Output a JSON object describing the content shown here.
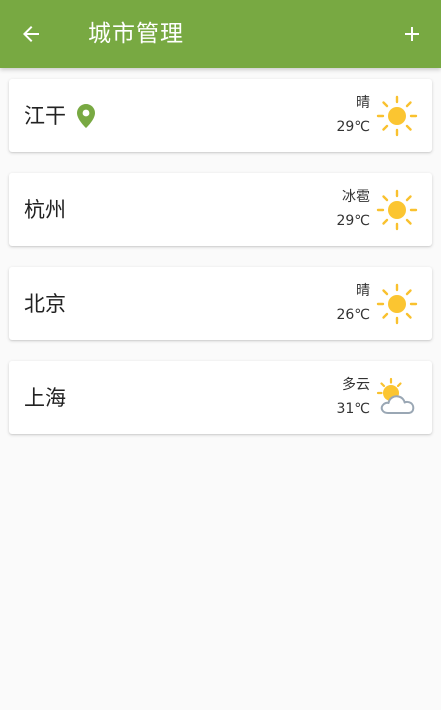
{
  "app_bar": {
    "title": "城市管理",
    "back_icon": "arrow-left-icon",
    "add_icon": "plus-icon",
    "color": "#78a942"
  },
  "cities": [
    {
      "name": "江干",
      "located": true,
      "condition": "晴",
      "temperature": "29℃",
      "icon": "sun-icon"
    },
    {
      "name": "杭州",
      "located": false,
      "condition": "冰雹",
      "temperature": "29℃",
      "icon": "sun-icon"
    },
    {
      "name": "北京",
      "located": false,
      "condition": "晴",
      "temperature": "26℃",
      "icon": "sun-icon"
    },
    {
      "name": "上海",
      "located": false,
      "condition": "多云",
      "temperature": "31℃",
      "icon": "cloud-sun-icon"
    }
  ],
  "colors": {
    "sun": "#fbc531",
    "sun_ray": "#f9c12e",
    "cloud": "#9aa7b4",
    "pin": "#78a942"
  }
}
